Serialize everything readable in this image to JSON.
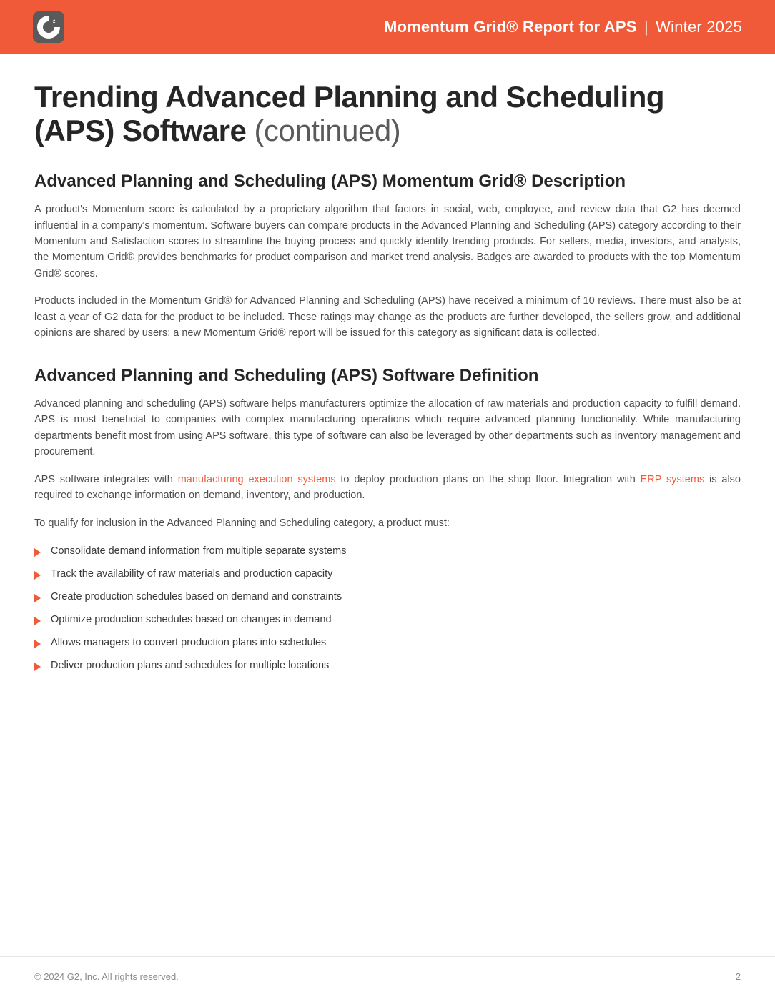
{
  "header": {
    "report_bold": "Momentum Grid® Report for APS",
    "report_period": "Winter 2025"
  },
  "title": {
    "main": "Trending Advanced Planning and Scheduling (APS) Software",
    "suffix": " (continued)"
  },
  "sections": {
    "desc_heading": "Advanced Planning and Scheduling (APS) Momentum Grid® Description",
    "desc_p1": "A product's Momentum score is calculated by a proprietary algorithm that factors in social, web, employee, and review data that G2 has deemed influential in a company's momentum. Software buyers can compare products in the Advanced Planning and Scheduling (APS) category according to their Momentum and Satisfaction scores to streamline the buying process and quickly identify trending products. For sellers, media, investors, and analysts, the Momentum Grid® provides benchmarks for product comparison and market trend analysis. Badges are awarded to products with the top Momentum Grid® scores.",
    "desc_p2": "Products included in the Momentum Grid® for Advanced Planning and Scheduling (APS) have received a minimum of 10 reviews. There must also be at least a year of G2 data for the product to be included. These ratings may change as the products are further developed, the sellers grow, and additional opinions are shared by users; a new Momentum Grid® report will be issued for this category as significant data is collected.",
    "def_heading": "Advanced Planning and Scheduling (APS) Software Definition",
    "def_p1": "Advanced planning and scheduling (APS) software helps manufacturers optimize the allocation of raw materials and production capacity to fulfill demand. APS is most beneficial to companies with complex manufacturing operations which require advanced planning functionality. While manufacturing departments benefit most from using APS software, this type of software can also be leveraged by other departments such as inventory management and procurement.",
    "def_p2_prefix": "APS software integrates with ",
    "def_p2_link1": "manufacturing execution systems",
    "def_p2_mid": " to deploy production plans on the shop floor. Integration with ",
    "def_p2_link2": "ERP systems",
    "def_p2_suffix": " is also required to exchange information on demand, inventory, and production.",
    "def_p3": "To qualify for inclusion in the Advanced Planning and Scheduling category, a product must:",
    "bullets": [
      "Consolidate demand information from multiple separate systems",
      "Track the availability of raw materials and production capacity",
      "Create production schedules based on demand and constraints",
      "Optimize production schedules based on changes in demand",
      "Allows managers to convert production plans into schedules",
      "Deliver production plans and schedules for multiple locations"
    ]
  },
  "footer": {
    "copyright": "© 2024 G2, Inc. All rights reserved.",
    "page_number": "2"
  }
}
